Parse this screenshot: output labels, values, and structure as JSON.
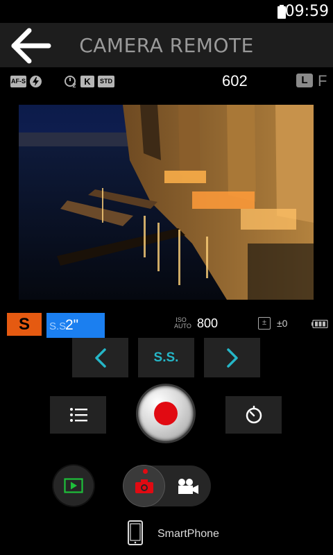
{
  "status_bar": {
    "time": "09:59",
    "battery_icon": "battery-full-icon"
  },
  "header": {
    "back_icon": "arrow-left-icon",
    "title": "CAMERA REMOTE"
  },
  "info_row": {
    "focus_mode": "AF-S",
    "flash_icon": "flash-auto-icon",
    "self_timer": "2",
    "white_balance": "K",
    "film_sim": "STD",
    "shots_remaining": "602",
    "image_quality": "L",
    "image_size": "F"
  },
  "settings": {
    "exposure_mode": "S",
    "shutter_speed_label": "S.S.",
    "shutter_speed_value": "2\"",
    "iso_icon_top": "ISO",
    "iso_icon_bottom": "AUTO",
    "iso_value": "800",
    "exposure_comp": "±0",
    "camera_battery_icon": "battery-level-icon"
  },
  "controls": {
    "prev_icon": "chevron-left-icon",
    "parameter_button": "S.S.",
    "next_icon": "chevron-right-icon",
    "menu_icon": "list-icon",
    "shutter_icon": "record-icon",
    "timer_icon": "timer-icon"
  },
  "bottom": {
    "playback_icon": "playback-icon",
    "photo_mode_icon": "camera-icon",
    "video_mode_icon": "video-camera-icon",
    "device_icon": "smartphone-icon",
    "device_label": "SmartPhone"
  },
  "colors": {
    "accent_orange": "#e55a11",
    "accent_blue": "#1b7ff0",
    "accent_teal": "#25b6c7",
    "record_red": "#e10a12",
    "playback_green": "#1ec03a"
  }
}
